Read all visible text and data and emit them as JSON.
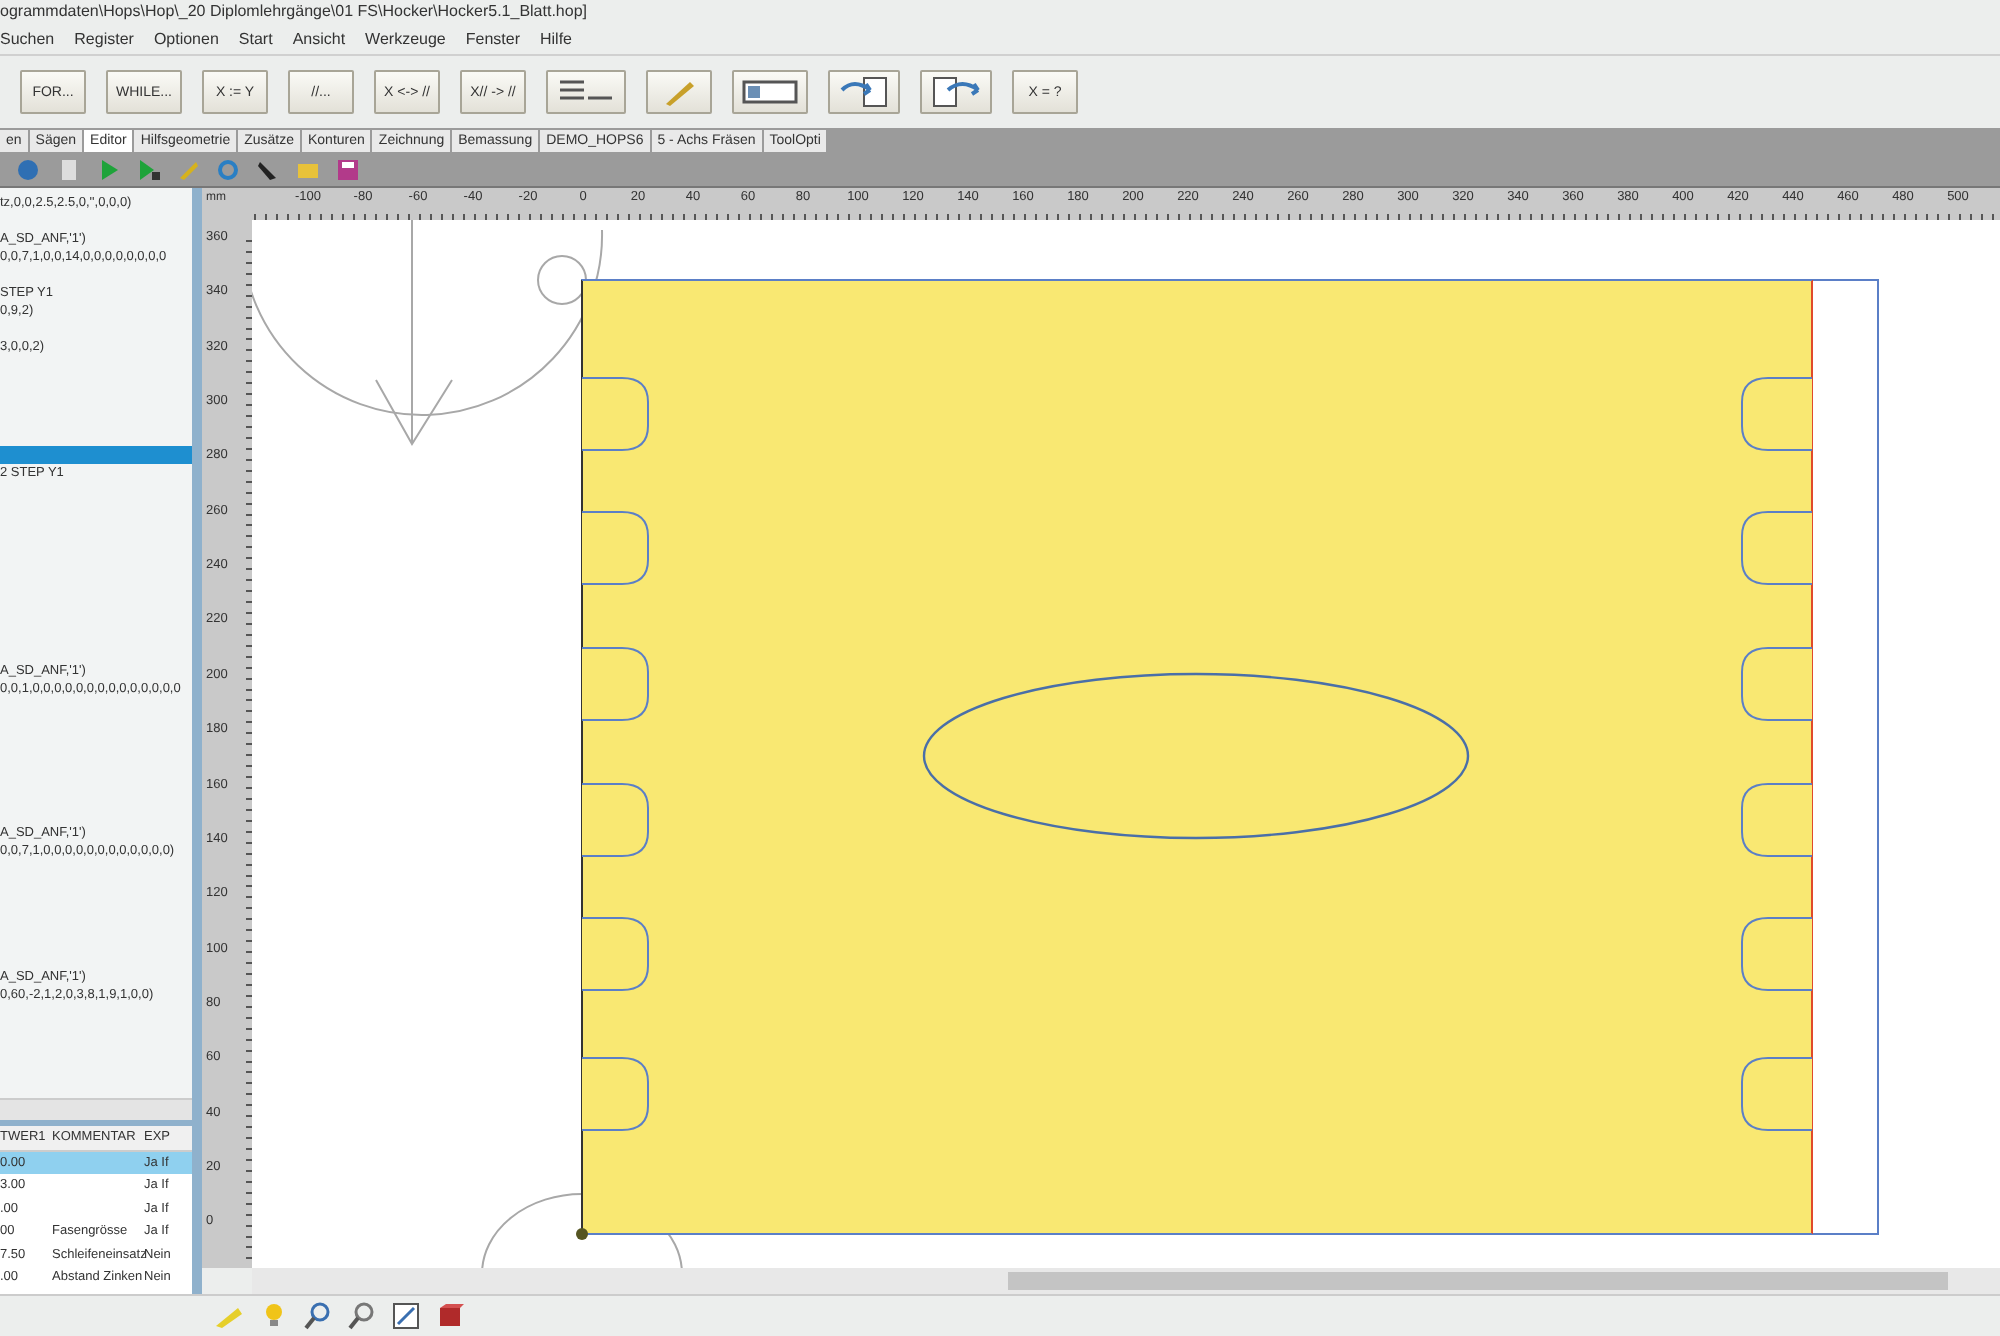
{
  "window": {
    "title": "ogrammdaten\\Hops\\Hop\\_20 Diplomlehrgänge\\01 FS\\Hocker\\Hocker5.1_Blatt.hop]"
  },
  "menu": [
    "Suchen",
    "Register",
    "Optionen",
    "Start",
    "Ansicht",
    "Werkzeuge",
    "Fenster",
    "Hilfe"
  ],
  "toolbar": [
    {
      "kind": "label",
      "label": "FOR..."
    },
    {
      "kind": "label",
      "label": "WHILE..."
    },
    {
      "kind": "label",
      "label": "X := Y"
    },
    {
      "kind": "label",
      "label": "//..."
    },
    {
      "kind": "label",
      "label": "X <-> //"
    },
    {
      "kind": "label",
      "label": "X// -> //"
    },
    {
      "kind": "list"
    },
    {
      "kind": "pen"
    },
    {
      "kind": "frame"
    },
    {
      "kind": "import"
    },
    {
      "kind": "export"
    },
    {
      "kind": "label",
      "label": "X = ?"
    }
  ],
  "tabs": [
    {
      "label": "en",
      "selected": false
    },
    {
      "label": "Sägen",
      "selected": false
    },
    {
      "label": "Editor",
      "selected": true
    },
    {
      "label": "Hilfsgeometrie",
      "selected": false
    },
    {
      "label": "Zusätze",
      "selected": false
    },
    {
      "label": "Konturen",
      "selected": false
    },
    {
      "label": "Zeichnung",
      "selected": false
    },
    {
      "label": "Bemassung",
      "selected": false
    },
    {
      "label": "DEMO_HOPS6",
      "selected": false
    },
    {
      "label": "5 - Achs Fräsen",
      "selected": false
    },
    {
      "label": "ToolOpti",
      "selected": false
    }
  ],
  "code_lines": [
    {
      "text": "tz,0,0,2.5,2.5,0,'',0,0,0)",
      "selected": false
    },
    {
      "text": "A_SD_ANF,'1')",
      "selected": false
    },
    {
      "text": "0,0,7,1,0,0,14,0,0,0,0,0,0,0,0",
      "selected": false
    },
    {
      "text": "STEP Y1",
      "selected": false
    },
    {
      "text": "0,9,2)",
      "selected": false
    },
    {
      "text": "3,0,0,2)",
      "selected": false
    },
    {
      "selected": true
    },
    {
      "text": "2 STEP Y1",
      "selected": false
    },
    {
      "text": "A_SD_ANF,'1')",
      "selected": false
    },
    {
      "text": "0,0,1,0,0,0,0,0,0,0,0,0,0,0,0,0,0",
      "selected": false
    },
    {
      "text": "A_SD_ANF,'1')",
      "selected": false
    },
    {
      "text": "0,0,7,1,0,0,0,0,0,0,0,0,0,0,0,0)",
      "selected": false
    },
    {
      "text": "A_SD_ANF,'1')",
      "selected": false
    },
    {
      "text": "0,60,-2,1,2,0,3,8,1,9,1,0,0)",
      "selected": false
    }
  ],
  "variables_table": {
    "columns": [
      "TWER1",
      "KOMMENTAR",
      "EXP"
    ],
    "rows": [
      {
        "cells": [
          "0.00",
          "",
          "Ja If"
        ],
        "selected": true
      },
      {
        "cells": [
          "3.00",
          "",
          "Ja If"
        ],
        "selected": false
      },
      {
        "cells": [
          ".00",
          "",
          "Ja If"
        ],
        "selected": false
      },
      {
        "cells": [
          "00",
          "Fasengrösse",
          "Ja If"
        ],
        "selected": false
      },
      {
        "cells": [
          "7.50",
          "Schleifeneinsatz",
          "Nein"
        ],
        "selected": false
      },
      {
        "cells": [
          ".00",
          "Abstand Zinken",
          "Nein"
        ],
        "selected": false
      }
    ]
  },
  "ruler": {
    "unit": "mm",
    "x_labels": [
      "-100",
      "-80",
      "-60",
      "-40",
      "-20",
      "0",
      "20",
      "40",
      "60",
      "80",
      "100",
      "120",
      "140",
      "160",
      "180",
      "200",
      "220",
      "240",
      "260",
      "280",
      "300",
      "320",
      "340",
      "360",
      "380",
      "400",
      "420",
      "440",
      "460",
      "480",
      "500"
    ],
    "y_labels": [
      "360",
      "340",
      "320",
      "300",
      "280",
      "260",
      "240",
      "220",
      "200",
      "180",
      "160",
      "140",
      "120",
      "100",
      "80",
      "60",
      "40",
      "20",
      "0"
    ]
  }
}
